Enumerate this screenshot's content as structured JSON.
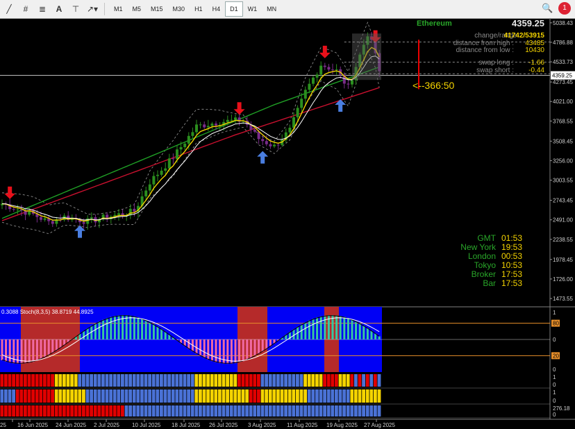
{
  "toolbar": {
    "timeframes": [
      "M1",
      "M5",
      "M15",
      "M30",
      "H1",
      "H4",
      "D1",
      "W1",
      "MN"
    ],
    "active_timeframe": "D1",
    "notification_count": "1"
  },
  "info_panel": {
    "symbol": "Ethereum",
    "price": "4359.25",
    "change_range_label": "change/range :",
    "change_range_value": "41742/53915",
    "distance_from_high_label": "distance from high :",
    "distance_from_high_value": "43485",
    "distance_from_low_label": "distance from low :",
    "distance_from_low_value": "10430",
    "swap_long_label": "swap long :",
    "swap_long_value": "-1.66",
    "swap_short_label": "swap short :",
    "swap_short_value": "-0.44",
    "countdown": "<--366:50"
  },
  "clock": {
    "rows": [
      {
        "label": "GMT",
        "value": "01:53"
      },
      {
        "label": "New York",
        "value": "19:53"
      },
      {
        "label": "London",
        "value": "00:53"
      },
      {
        "label": "Tokyo",
        "value": "10:53"
      },
      {
        "label": "Broker",
        "value": "17:53"
      },
      {
        "label": "Bar",
        "value": "17:53"
      }
    ]
  },
  "price_axis": {
    "labels": [
      "5038.43",
      "4786.88",
      "4533.73",
      "4359.25",
      "4273.45",
      "4021.00",
      "3768.55",
      "3508.45",
      "3256.00",
      "3003.55",
      "2743.45",
      "2491.00",
      "2238.55",
      "1978.45",
      "1726.00",
      "1473.55"
    ],
    "current_price": "4359.25"
  },
  "stoch": {
    "label_prefix": "0.3088",
    "label": "Stoch(8,3,5) 38.8719 44.8925",
    "axis_labels": [
      "1",
      "80",
      "0",
      "20",
      "0"
    ]
  },
  "strip1_axis": [
    "1",
    "0"
  ],
  "strip2_axis": [
    "1",
    "0"
  ],
  "strip3_axis": [
    "276.18",
    "0"
  ],
  "date_axis": [
    "25",
    "16 Jun 2025",
    "24 Jun 2025",
    "2 Jul 2025",
    "10 Jul 2025",
    "18 Jul 2025",
    "26 Jul 2025",
    "3 Aug 2025",
    "11 Aug 2025",
    "19 Aug 2025",
    "27 Aug 2025"
  ],
  "colors": {
    "bull": "#2b8f1e",
    "bear": "#7a2c8a",
    "ema_fast": "#f2d200",
    "ema_slow": "#ffffff",
    "ma_green": "#1f9e25",
    "ma_red": "#c8102e",
    "stoch_bg": "#0000f5",
    "stoch_zone": "#b52a2a",
    "strip_red": "#e10000",
    "strip_yellow": "#f5d400",
    "strip_blue": "#4a72d6",
    "info_green": "#29a629"
  }
}
